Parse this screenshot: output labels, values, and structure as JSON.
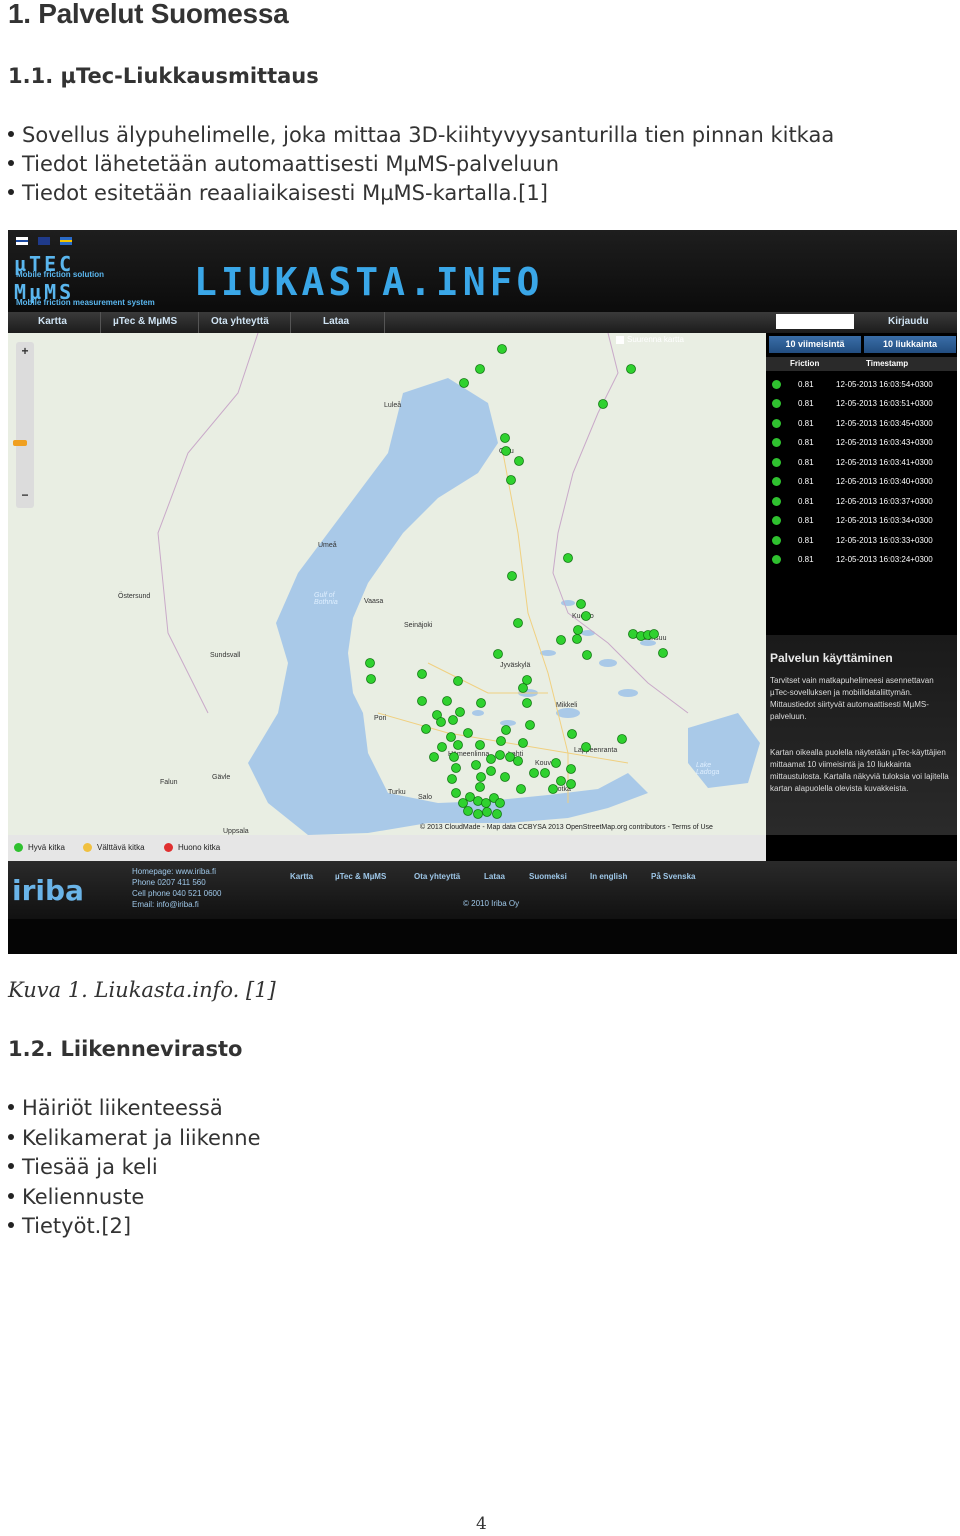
{
  "heading1": "1. Palvelut Suomessa",
  "section1": {
    "title": "1.1. µTec-Liukkausmittaus",
    "bullets": [
      "Sovellus älypuhelimelle, joka mittaa 3D-kiihtyvyysanturilla tien pinnan kitkaa",
      "Tiedot lähetetään automaattisesti MµMS-palveluun",
      "Tiedot esitetään reaaliaikaisesti MµMS-kartalla.[1]"
    ]
  },
  "screenshot": {
    "logo_utec": "µTEC",
    "logo_tagline1": "Mobile friction solution",
    "logo_mums": "MµMS",
    "logo_tagline2": "Mobile friction measurement system",
    "site_title": "LIUKASTA.INFO",
    "nav": [
      "Kartta",
      "µTec & MµMS",
      "Ota yhteyttä",
      "Lataa"
    ],
    "login": "Kirjaudu",
    "checkbox_label": "Suurenna kartta",
    "tabs": [
      "10 viimeisintä",
      "10 liukkainta"
    ],
    "table_headers": [
      "Friction",
      "Timestamp"
    ],
    "rows": [
      {
        "friction": "0.81",
        "timestamp": "12-05-2013 16:03:54+0300"
      },
      {
        "friction": "0.81",
        "timestamp": "12-05-2013 16:03:51+0300"
      },
      {
        "friction": "0.81",
        "timestamp": "12-05-2013 16:03:45+0300"
      },
      {
        "friction": "0.81",
        "timestamp": "12-05-2013 16:03:43+0300"
      },
      {
        "friction": "0.81",
        "timestamp": "12-05-2013 16:03:41+0300"
      },
      {
        "friction": "0.81",
        "timestamp": "12-05-2013 16:03:40+0300"
      },
      {
        "friction": "0.81",
        "timestamp": "12-05-2013 16:03:37+0300"
      },
      {
        "friction": "0.81",
        "timestamp": "12-05-2013 16:03:34+0300"
      },
      {
        "friction": "0.81",
        "timestamp": "12-05-2013 16:03:33+0300"
      },
      {
        "friction": "0.81",
        "timestamp": "12-05-2013 16:03:24+0300"
      }
    ],
    "panel_title": "Palvelun käyttäminen",
    "panel_text1": "Tarvitset vain matkapuhelimeesi asennettavan µTec-sovelluksen ja mobiilidataliittymän. Mittaustiedot siirtyvät automaattisesti MµMS-palveluun.",
    "panel_text2": "Kartan oikealla puolella näytetään µTec-käyttäjien mittaamat 10 viimeisintä ja 10 liukkainta mittaustulosta. Kartalla näkyviä tuloksia voi lajitella kartan alapuolella olevista kuvakkeista.",
    "map_labels": [
      "Luleå",
      "Oulu",
      "Umeå",
      "Östersund",
      "Vaasa",
      "Seinäjoki",
      "Kuopio",
      "Joensuu",
      "Sundsvall",
      "Jyväskylä",
      "Mikkeli",
      "Pori",
      "Hämeenlinna",
      "Lahti",
      "Lappeenranta",
      "Kouvola",
      "Kotka",
      "Turku",
      "Salo",
      "Falun",
      "Gävle",
      "Uppsala"
    ],
    "sea_labels": [
      "Gulf of Bothnia",
      "Lake Ladoga"
    ],
    "map_copyright": "© 2013 CloudMade - Map data CCBYSA 2013 OpenStreetMap.org contributors - Terms of Use",
    "legend": [
      "Hyvä kitka",
      "Välttävä kitka",
      "Huono kitka"
    ],
    "colors": {
      "good": "#2fc12f",
      "moderate": "#f0c040",
      "bad": "#e03030",
      "water": "#a9c9e8",
      "land": "#e9eee3"
    },
    "footer_logo": "iriba",
    "footer_contact": [
      "Homepage: www.iriba.fi",
      "Phone 0207 411 560",
      "Cell phone 040 521 0600",
      "Email: info@iriba.fi"
    ],
    "footer_nav": [
      "Kartta",
      "µTec & MµMS",
      "Ota yhteyttä",
      "Lataa",
      "Suomeksi",
      "In english",
      "På Svenska"
    ],
    "footer_copy": "© 2010 Iriba Oy"
  },
  "caption": "Kuva 1. Liukasta.info. [1]",
  "section2": {
    "title": "1.2. Liikennevirasto",
    "bullets": [
      "Häiriöt liikenteessä",
      "Kelikamerat ja liikenne",
      "Tiesää ja keli",
      "Keliennuste",
      "Tietyöt.[2]"
    ]
  },
  "page_number": "4"
}
